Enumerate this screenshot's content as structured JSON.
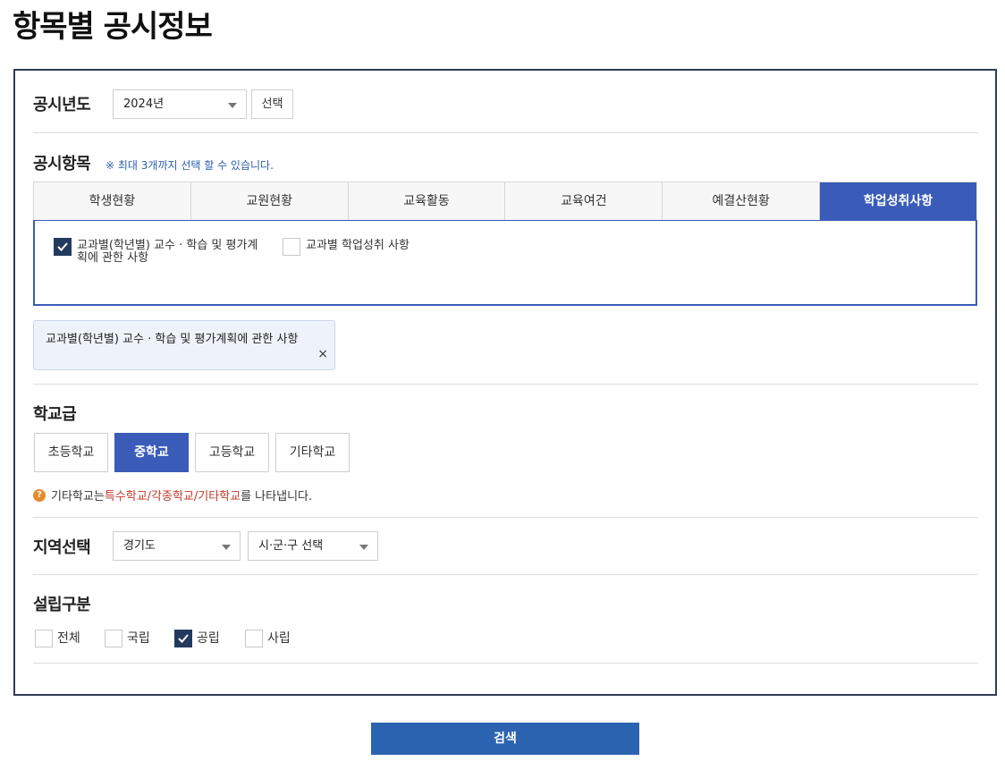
{
  "page_title": "항목별 공시정보",
  "year": {
    "label": "공시년도",
    "selected": "2024년",
    "select_button": "선택"
  },
  "items": {
    "label": "공시항목",
    "note": "※ 최대 3개까지 선택 할 수 있습니다.",
    "tabs": [
      {
        "label": "학생현황"
      },
      {
        "label": "교원현황"
      },
      {
        "label": "교육활동"
      },
      {
        "label": "교육여건"
      },
      {
        "label": "예결산현황"
      },
      {
        "label": "학업성취사항"
      }
    ],
    "active_tab": "학업성취사항",
    "options": [
      {
        "label_line1": "교과별(학년별) 교수 · 학습 및 평가계",
        "label_line2": "획에 관한 사항",
        "checked": true
      },
      {
        "label_line1": "교과별 학업성취 사항",
        "label_line2": "",
        "checked": false
      }
    ],
    "selected_chip": "교과별(학년별) 교수 · 학습 및 평가계획에 관한 사항",
    "chip_remove": "×"
  },
  "school_level": {
    "label": "학교급",
    "buttons": [
      {
        "label": "초등학교"
      },
      {
        "label": "중학교"
      },
      {
        "label": "고등학교"
      },
      {
        "label": "기타학교"
      }
    ],
    "active": "중학교",
    "help_prefix": "기타학교는 ",
    "help_highlight": "특수학교/각종학교/기타학교",
    "help_suffix": "를 나타냅니다.",
    "help_icon": "?"
  },
  "region": {
    "label": "지역선택",
    "province": "경기도",
    "district": "시·군·구 선택"
  },
  "establishment": {
    "label": "설립구분",
    "options": [
      {
        "label": "전체",
        "checked": false
      },
      {
        "label": "국립",
        "checked": false
      },
      {
        "label": "공립",
        "checked": true
      },
      {
        "label": "사립",
        "checked": false
      }
    ]
  },
  "search_button": "검색",
  "colors": {
    "accent": "#3a5cb8",
    "panel_border": "#2f3d55",
    "checkbox_checked": "#223a5e",
    "search_button": "#2b63b0",
    "help_icon": "#e98a2c",
    "highlight_red": "#c0392b"
  }
}
